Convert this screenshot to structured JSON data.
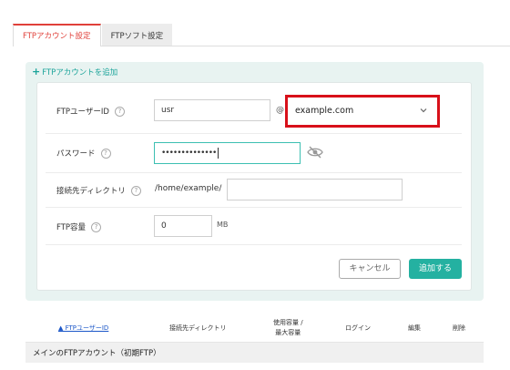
{
  "tabs": {
    "account": "FTPアカウント設定",
    "soft": "FTPソフト設定"
  },
  "add_section": {
    "title": "FTPアカウントを追加",
    "plus": "+"
  },
  "form": {
    "user_label": "FTPユーザーID",
    "user_value": "usr",
    "at": "@",
    "domain_selected": "example.com",
    "password_label": "パスワード",
    "password_mask": "••••••••••••••",
    "dir_label": "接続先ディレクトリ",
    "dir_prefix": "/home/example/",
    "dir_value": "",
    "capacity_label": "FTP容量",
    "capacity_value": "0",
    "capacity_unit": "MB",
    "help": "?",
    "cancel": "キャンセル",
    "submit": "追加する"
  },
  "table": {
    "col_user": "▲ FTPユーザーID",
    "col_dir": "接続先ディレクトリ",
    "col_usage_1": "使用容量",
    "col_usage_sep": "/",
    "col_usage_2": "最大容量",
    "col_login": "ログイン",
    "col_edit": "編集",
    "col_delete": "削除",
    "group_main": "メインのFTPアカウント（初期FTP）"
  },
  "colors": {
    "accent": "#24b1a1",
    "active_tab": "#e0403a",
    "highlight": "#d8101a",
    "link": "#1a56c8"
  }
}
